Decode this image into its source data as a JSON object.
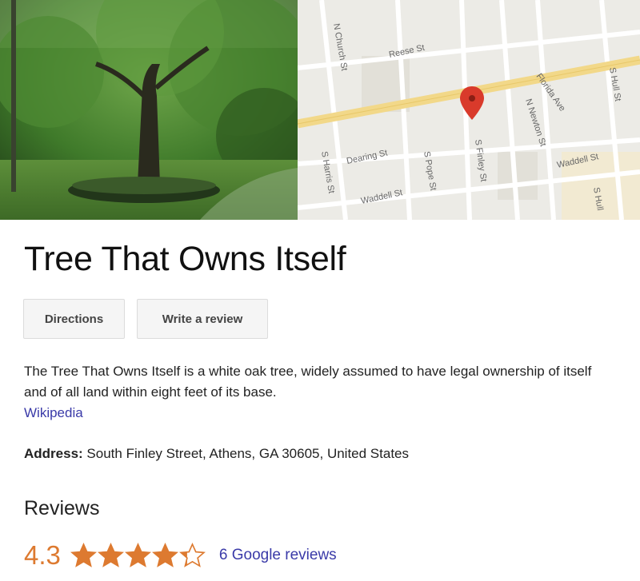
{
  "panel": {
    "title": "Tree That Owns Itself",
    "actions": {
      "directions": "Directions",
      "write_review": "Write a review"
    },
    "description": "The Tree That Owns Itself is a white oak tree, widely assumed to have legal ownership of itself and of all land within eight feet of its base.",
    "source_link": "Wikipedia",
    "address": {
      "label": "Address:",
      "value": "South Finley Street, Athens, GA 30605, United States"
    },
    "reviews": {
      "heading": "Reviews",
      "rating": "4.3",
      "rating_value": 4.3,
      "rating_max": 5,
      "count_link": "6 Google reviews"
    }
  },
  "map": {
    "streets": [
      "Reese St",
      "N Church St",
      "Dearing St",
      "S Harris St",
      "Waddell St",
      "S Pope St",
      "S Finley St",
      "N Newton St",
      "Florida Ave",
      "Waddell St",
      "S Hull St",
      "S Hull"
    ],
    "pin_icon": "map-pin-icon"
  },
  "colors": {
    "accent_orange": "#dd7a30",
    "link_blue": "#3a3aa8",
    "pin_red": "#d93a2b",
    "road_yellow": "#f2d889"
  }
}
